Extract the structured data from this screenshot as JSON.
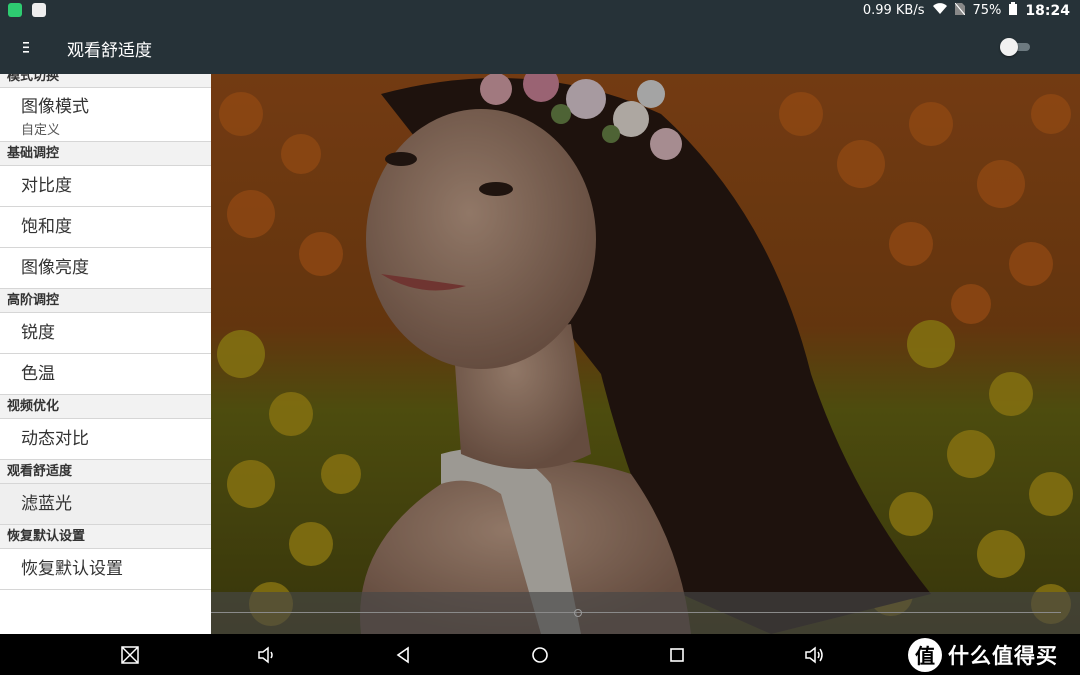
{
  "statusbar": {
    "network_speed": "0.99 KB/s",
    "battery": "75%",
    "time": "18:24"
  },
  "appbar": {
    "title": "观看舒适度",
    "toggle_state": "off"
  },
  "menu": {
    "cut_header": "模式切换",
    "picture_mode_label": "图像模式",
    "picture_mode_value": "自定义",
    "section_basic": "基础调控",
    "contrast": "对比度",
    "saturation": "饱和度",
    "brightness": "图像亮度",
    "section_advanced": "高阶调控",
    "sharpness": "锐度",
    "color_temp": "色温",
    "section_video": "视频优化",
    "dynamic_contrast": "动态对比",
    "section_comfort": "观看舒适度",
    "blue_light_filter": "滤蓝光",
    "section_reset": "恢复默认设置",
    "reset_item": "恢复默认设置"
  },
  "watermark": {
    "logo": "值",
    "text": "什么值得买"
  },
  "colors": {
    "appbar_bg": "#263238",
    "panel_bg": "#ffffff",
    "navbar_bg": "#000000"
  }
}
